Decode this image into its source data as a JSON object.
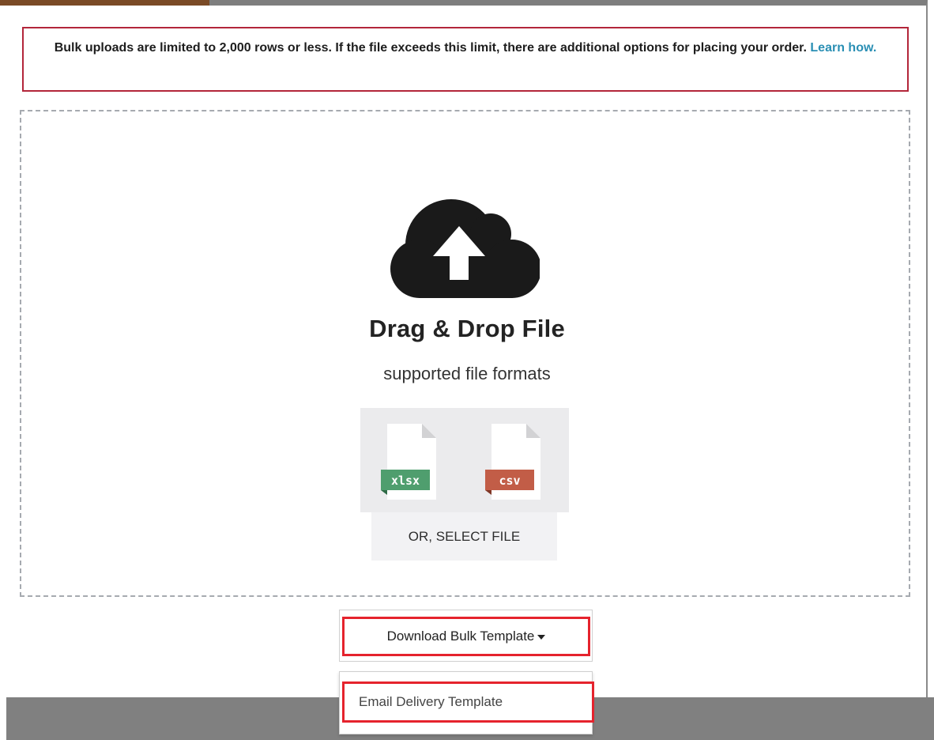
{
  "notice": {
    "text": "Bulk uploads are limited to 2,000 rows or less. If the file exceeds this limit, there are additional options for placing your order.",
    "link_label": "Learn how."
  },
  "dropzone": {
    "icon": "cloud-upload-icon",
    "title": "Drag & Drop File",
    "subtitle": "supported file formats",
    "formats": [
      {
        "label": "xlsx",
        "color": "#4f9e6e",
        "icon": "xlsx-file-icon"
      },
      {
        "label": "csv",
        "color": "#c25d47",
        "icon": "csv-file-icon"
      }
    ],
    "select_label": "OR, SELECT FILE"
  },
  "download": {
    "button_label": "Download Bulk Template",
    "menu_items": [
      "Email Delivery Template"
    ]
  },
  "colors": {
    "link": "#2a8fb4",
    "notice_border": "#b3263a",
    "highlight": "#e5232d"
  }
}
